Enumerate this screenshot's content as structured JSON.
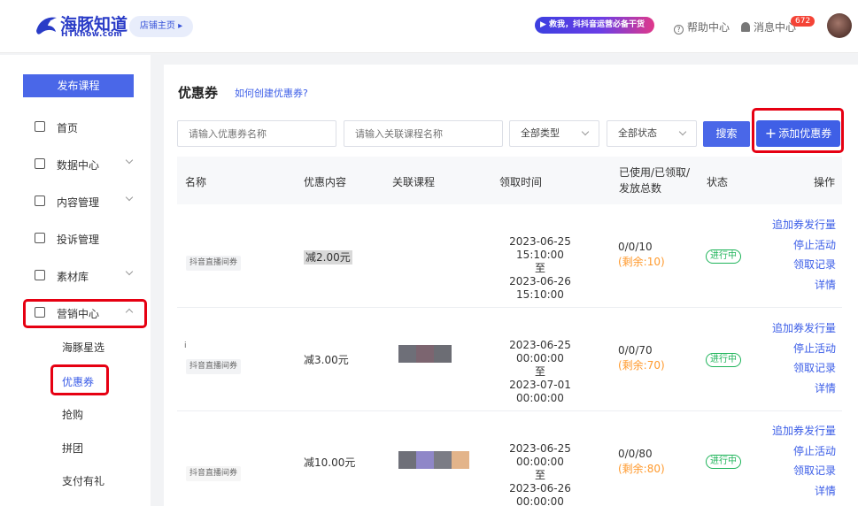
{
  "header": {
    "logo_title": "海豚知道",
    "logo_sub": "HTknow.com",
    "store_home": "店铺主页 ▸",
    "promo": "▶ 救我，抖抖音运营必备干货",
    "help": "帮助中心",
    "messages": "消息中心",
    "message_count": "672"
  },
  "sidebar": {
    "publish_button": "发布课程",
    "items": [
      {
        "label": "首页",
        "has_chevron": false
      },
      {
        "label": "数据中心",
        "has_chevron": true
      },
      {
        "label": "内容管理",
        "has_chevron": true
      },
      {
        "label": "投诉管理",
        "has_chevron": false
      },
      {
        "label": "素材库",
        "has_chevron": true
      },
      {
        "label": "营销中心",
        "has_chevron": true
      }
    ],
    "sub_items": [
      "海豚星选",
      "优惠券",
      "抢购",
      "拼团",
      "支付有礼"
    ],
    "active_sub": "优惠券"
  },
  "main": {
    "title": "优惠券",
    "help_link": "如何创建优惠券?",
    "filters": {
      "coupon_name_placeholder": "请输入优惠券名称",
      "course_name_placeholder": "请输入关联课程名称",
      "type_select": "全部类型",
      "status_select": "全部状态",
      "search_button": "搜索",
      "add_button": "添加优惠券"
    },
    "table": {
      "headers": [
        "名称",
        "优惠内容",
        "关联课程",
        "领取时间",
        "已使用/已领取/发放总数",
        "状态",
        "操作"
      ],
      "rows": [
        {
          "name_prefix": "",
          "tag": "抖音直播间券",
          "discount": "减2.00元",
          "time_start": "2023-06-25 15:10:00",
          "time_sep": "至",
          "time_end": "2023-06-26 15:10:00",
          "counts": "0/0/10",
          "remaining": "(剩余:10)",
          "status": "进行中"
        },
        {
          "name_prefix": "i",
          "tag": "抖音直播间券",
          "discount": "减3.00元",
          "time_start": "2023-06-25 00:00:00",
          "time_sep": "至",
          "time_end": "2023-07-01 00:00:00",
          "counts": "0/0/70",
          "remaining": "(剩余:70)",
          "status": "进行中"
        },
        {
          "name_prefix": "",
          "tag": "抖音直播间券",
          "discount": "减10.00元",
          "time_start": "2023-06-25 00:00:00",
          "time_sep": "至",
          "time_end": "2023-06-26 00:00:00",
          "counts": "0/0/80",
          "remaining": "(剩余:80)",
          "status": "进行中"
        }
      ],
      "operations": [
        "追加券发行量",
        "停止活动",
        "领取记录",
        "详情"
      ]
    }
  },
  "colors": {
    "primary": "#4a67e8",
    "link": "#3b5de7",
    "status_green": "#1fb45a",
    "remaining_orange": "#ff9a2e",
    "highlight_red": "#e60012"
  }
}
